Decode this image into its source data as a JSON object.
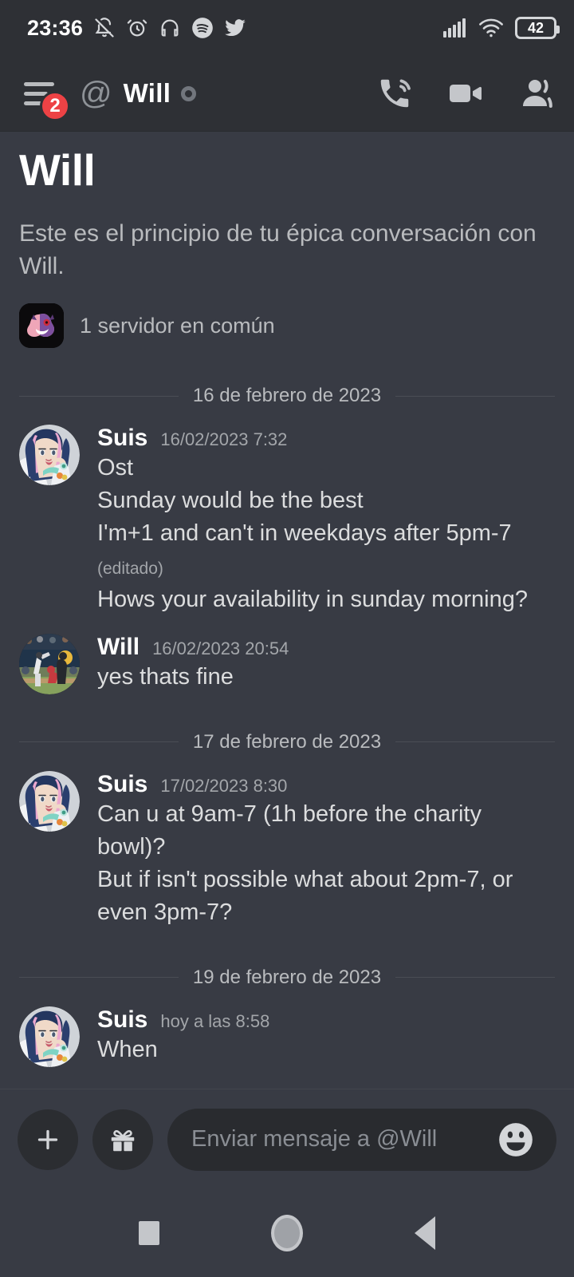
{
  "status_bar": {
    "time": "23:36",
    "left_icons": [
      "bell-off-icon",
      "alarm-clock-icon",
      "headphones-icon",
      "spotify-icon",
      "twitter-icon"
    ],
    "right_icons": [
      "cellular-signal-icon",
      "wifi-icon"
    ],
    "battery_level": "42"
  },
  "header": {
    "menu_badge": "2",
    "at_symbol": "@",
    "title": "Will",
    "presence": "offline",
    "actions": [
      "voice-call-icon",
      "video-call-icon",
      "user-profile-icon"
    ]
  },
  "intro": {
    "title": "Will",
    "description": "Este es el principio de tu épica conversación con Will.",
    "mutual_servers": "1 servidor en común"
  },
  "conversation": [
    {
      "kind": "divider",
      "label": "16 de febrero de 2023"
    },
    {
      "kind": "message",
      "author": "Suis",
      "timestamp": "16/02/2023 7:32",
      "avatar": "suis-avatar",
      "lines": [
        {
          "text": "Ost"
        },
        {
          "text": "Sunday would be the best"
        },
        {
          "text": "I'm+1 and can't in weekdays after 5pm-7",
          "edited": "(editado)"
        },
        {
          "text": "Hows your availability in sunday morning?"
        }
      ]
    },
    {
      "kind": "message",
      "author": "Will",
      "timestamp": "16/02/2023 20:54",
      "avatar": "will-avatar",
      "lines": [
        {
          "text": "yes thats fine"
        }
      ]
    },
    {
      "kind": "divider",
      "label": "17 de febrero de 2023"
    },
    {
      "kind": "message",
      "author": "Suis",
      "timestamp": "17/02/2023 8:30",
      "avatar": "suis-avatar",
      "lines": [
        {
          "text": "Can u at 9am-7 (1h before the charity bowl)?"
        },
        {
          "text": "But if isn't possible what about 2pm-7, or even 3pm-7?"
        }
      ]
    },
    {
      "kind": "divider",
      "label": "19 de febrero de 2023"
    },
    {
      "kind": "message",
      "author": "Suis",
      "timestamp": "hoy a las 8:58",
      "avatar": "suis-avatar",
      "lines": [
        {
          "text": "When"
        }
      ]
    }
  ],
  "composer": {
    "add_icon": "plus-icon",
    "gift_icon": "gift-icon",
    "placeholder": "Enviar mensaje a @Will",
    "emoji_icon": "emoji-icon"
  },
  "navigation_bar": {
    "recents": "square-icon",
    "home": "circle-icon",
    "back": "triangle-back-icon"
  },
  "colors": {
    "app_background": "#383b44",
    "header_background": "#2e3035",
    "badge_red": "#ed4245",
    "text_primary": "#ffffff",
    "text_secondary": "#b9bbbe",
    "text_body": "#dcddde",
    "input_background": "#292b2f"
  }
}
